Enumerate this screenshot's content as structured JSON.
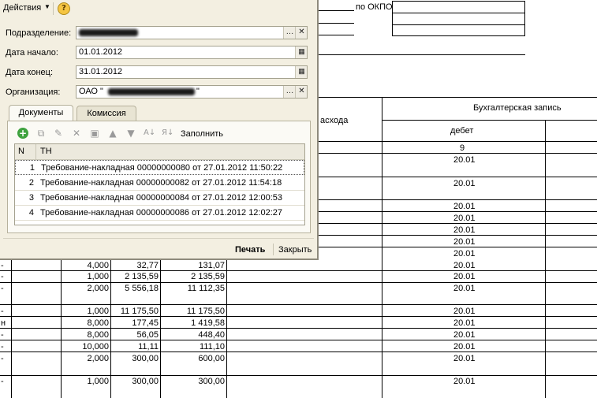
{
  "report": {
    "okpo_label": "по ОКПО",
    "header_partial": "асхода",
    "header_buh": "Бухгалтерская запись",
    "header_debet": "дебет",
    "col_num": "9",
    "rows": [
      {
        "c1": "",
        "qty": "",
        "price": "",
        "sum": "",
        "debet": "20.01"
      },
      {
        "c1": "",
        "qty": "",
        "price": "",
        "sum": "",
        "debet": "20.01"
      },
      {
        "c1": "",
        "qty": "",
        "price": "",
        "sum": "",
        "debet": "20.01"
      },
      {
        "c1": "",
        "qty": "",
        "price": "",
        "sum": "",
        "debet": "20.01"
      },
      {
        "c1": "",
        "qty": "",
        "price": "",
        "sum": "",
        "debet": "20.01"
      },
      {
        "c1": "",
        "qty": "",
        "price": "",
        "sum": "",
        "debet": "20.01"
      },
      {
        "c1": "",
        "qty": "",
        "price": "",
        "sum": "",
        "debet": "20.01"
      },
      {
        "c1": "",
        "qty": "",
        "price": "",
        "sum": "",
        "debet": "20.01"
      },
      {
        "c1": "-",
        "qty": "4,000",
        "price": "32,77",
        "sum": "131,07",
        "debet": "20.01"
      },
      {
        "c1": "-",
        "qty": "1,000",
        "price": "2 135,59",
        "sum": "2 135,59",
        "debet": "20.01"
      },
      {
        "c1": "-",
        "qty": "2,000",
        "price": "5 556,18",
        "sum": "11 112,35",
        "debet": "20.01"
      },
      {
        "c1": "-",
        "qty": "1,000",
        "price": "11 175,50",
        "sum": "11 175,50",
        "debet": "20.01"
      },
      {
        "c1": "н",
        "qty": "8,000",
        "price": "177,45",
        "sum": "1 419,58",
        "debet": "20.01"
      },
      {
        "c1": "-",
        "qty": "8,000",
        "price": "56,05",
        "sum": "448,40",
        "debet": "20.01"
      },
      {
        "c1": "-",
        "qty": "10,000",
        "price": "11,11",
        "sum": "111,10",
        "debet": "20.01"
      },
      {
        "c1": "-",
        "qty": "2,000",
        "price": "300,00",
        "sum": "600,00",
        "debet": "20.01"
      },
      {
        "c1": "-",
        "qty": "1,000",
        "price": "300,00",
        "sum": "300,00",
        "debet": "20.01"
      }
    ]
  },
  "dialog": {
    "actions_menu": "Действия",
    "help_icon": "?",
    "subdivision_label": "Подразделение:",
    "start_date_label": "Дата начало:",
    "start_date_value": "01.01.2012",
    "end_date_label": "Дата конец:",
    "end_date_value": "31.01.2012",
    "org_label": "Организация:",
    "org_value": "ОАО  \"",
    "org_value_end": "\"",
    "tabs": [
      "Документы",
      "Комиссия"
    ],
    "fill_button": "Заполнить",
    "grid_headers": {
      "n": "N",
      "th": "ТН"
    },
    "grid_rows": [
      {
        "n": "1",
        "text": "Требование-накладная 00000000080 от 27.01.2012 11:50:22"
      },
      {
        "n": "2",
        "text": "Требование-накладная 00000000082 от 27.01.2012 11:54:18"
      },
      {
        "n": "3",
        "text": "Требование-накладная 00000000084 от 27.01.2012 12:00:53"
      },
      {
        "n": "4",
        "text": "Требование-накладная 00000000086 от 27.01.2012 12:02:27"
      }
    ],
    "print_button": "Печать",
    "close_button": "Закрыть"
  }
}
